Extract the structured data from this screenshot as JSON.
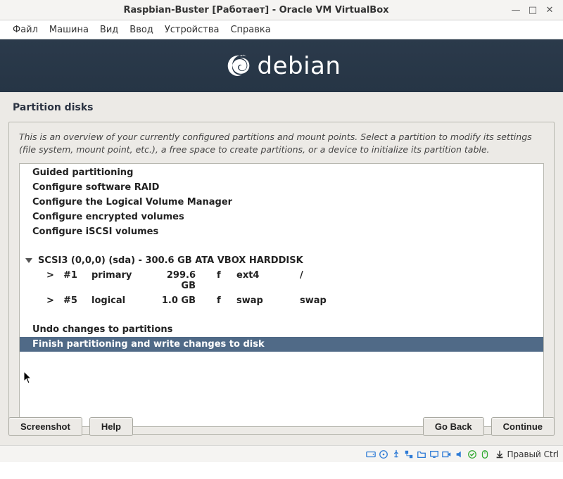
{
  "window": {
    "title": "Raspbian-Buster [Работает] - Oracle VM VirtualBox"
  },
  "menubar": {
    "items": [
      "Файл",
      "Машина",
      "Вид",
      "Ввод",
      "Устройства",
      "Справка"
    ]
  },
  "debian": {
    "brand": "debian"
  },
  "page": {
    "title": "Partition disks",
    "intro": "This is an overview of your currently configured partitions and mount points. Select a partition to modify its settings (file system, mount point, etc.), a free space to create partitions, or a device to initialize its partition table."
  },
  "list": {
    "top_items": [
      "Guided partitioning",
      "Configure software RAID",
      "Configure the Logical Volume Manager",
      "Configure encrypted volumes",
      "Configure iSCSI volumes"
    ],
    "disk": "SCSI3 (0,0,0) (sda) - 300.6 GB ATA VBOX HARDDISK",
    "partitions": [
      {
        "gt": ">",
        "num": "#1",
        "ptype": "primary",
        "size": "299.6 GB",
        "flag": "f",
        "fs": "ext4",
        "mount": "/"
      },
      {
        "gt": ">",
        "num": "#5",
        "ptype": "logical",
        "size": "1.0 GB",
        "flag": "f",
        "fs": "swap",
        "mount": "swap"
      }
    ],
    "undo": "Undo changes to partitions",
    "finish": "Finish partitioning and write changes to disk"
  },
  "buttons": {
    "screenshot": "Screenshot",
    "help": "Help",
    "go_back": "Go Back",
    "cont": "Continue"
  },
  "statusbar": {
    "host_key": "Правый Ctrl"
  }
}
